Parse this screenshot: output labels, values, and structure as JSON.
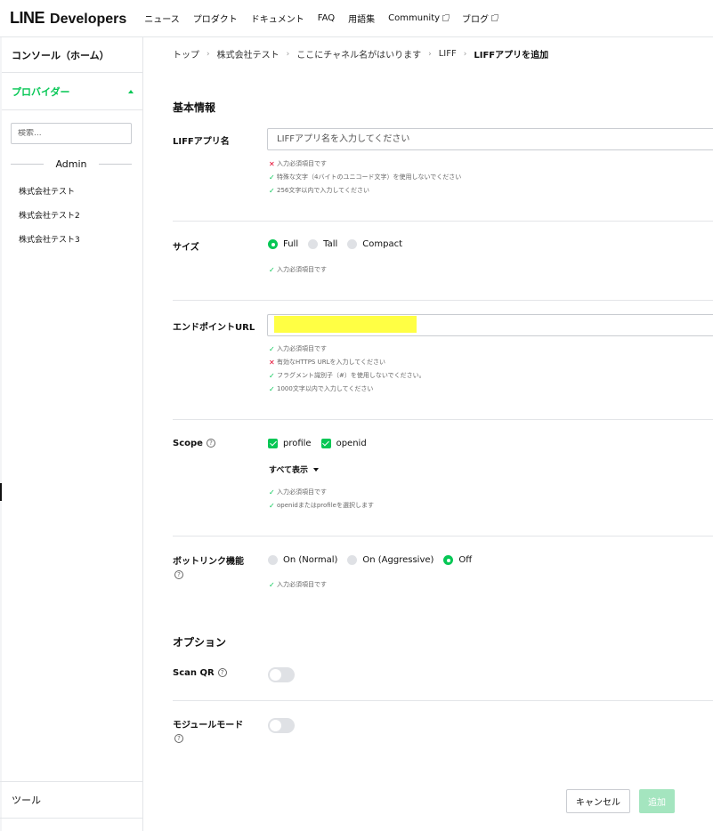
{
  "header": {
    "logo_line": "LINE",
    "logo_dev": "Developers",
    "nav": [
      {
        "label": "ニュース",
        "external": false
      },
      {
        "label": "プロダクト",
        "external": false
      },
      {
        "label": "ドキュメント",
        "external": false
      },
      {
        "label": "FAQ",
        "external": false
      },
      {
        "label": "用語集",
        "external": false
      },
      {
        "label": "Community",
        "external": true
      },
      {
        "label": "ブログ",
        "external": true
      }
    ]
  },
  "sidebar": {
    "console": "コンソール（ホーム）",
    "provider": "プロバイダー",
    "search_placeholder": "検索...",
    "group": "Admin",
    "items": [
      "株式会社テスト",
      "株式会社テスト2",
      "株式会社テスト3"
    ],
    "tool": "ツール"
  },
  "breadcrumb": [
    "トップ",
    "株式会社テスト",
    "ここにチャネル名がはいります",
    "LIFF",
    "LIFFアプリを追加"
  ],
  "form": {
    "basic_title": "基本情報",
    "app_name": {
      "label": "LIFFアプリ名",
      "placeholder": "LIFFアプリ名を入力してください",
      "rules": [
        {
          "ok": false,
          "text": "入力必須項目です"
        },
        {
          "ok": true,
          "text": "特殊な文字（4バイトのユニコード文字）を使用しないでください"
        },
        {
          "ok": true,
          "text": "256文字以内で入力してください"
        }
      ]
    },
    "size": {
      "label": "サイズ",
      "options": [
        {
          "label": "Full",
          "selected": true
        },
        {
          "label": "Tall",
          "selected": false
        },
        {
          "label": "Compact",
          "selected": false
        }
      ],
      "rules": [
        {
          "ok": true,
          "text": "入力必須項目です"
        }
      ]
    },
    "endpoint": {
      "label": "エンドポイントURL",
      "rules": [
        {
          "ok": true,
          "text": "入力必須項目です"
        },
        {
          "ok": false,
          "text": "有効なHTTPS URLを入力してください"
        },
        {
          "ok": true,
          "text": "フラグメント識別子（#）を使用しないでください。"
        },
        {
          "ok": true,
          "text": "1000文字以内で入力してください"
        }
      ]
    },
    "scope": {
      "label": "Scope",
      "options": [
        {
          "label": "profile",
          "checked": true
        },
        {
          "label": "openid",
          "checked": true
        }
      ],
      "show_all": "すべて表示",
      "rules": [
        {
          "ok": true,
          "text": "入力必須項目です"
        },
        {
          "ok": true,
          "text": "openidまたはprofileを選択します"
        }
      ]
    },
    "botlink": {
      "label": "ボットリンク機能",
      "options": [
        {
          "label": "On (Normal)",
          "selected": false
        },
        {
          "label": "On (Aggressive)",
          "selected": false
        },
        {
          "label": "Off",
          "selected": true
        }
      ],
      "rules": [
        {
          "ok": true,
          "text": "入力必須項目です"
        }
      ]
    },
    "options_title": "オプション",
    "scan_qr": {
      "label": "Scan QR",
      "on": false
    },
    "module_mode": {
      "label": "モジュールモード",
      "on": false
    }
  },
  "buttons": {
    "cancel": "キャンセル",
    "add": "追加"
  },
  "colors": {
    "accent": "#06c755",
    "error": "#e4032b",
    "highlight": "#ffff44",
    "add_disabled": "#a4e5bf"
  }
}
